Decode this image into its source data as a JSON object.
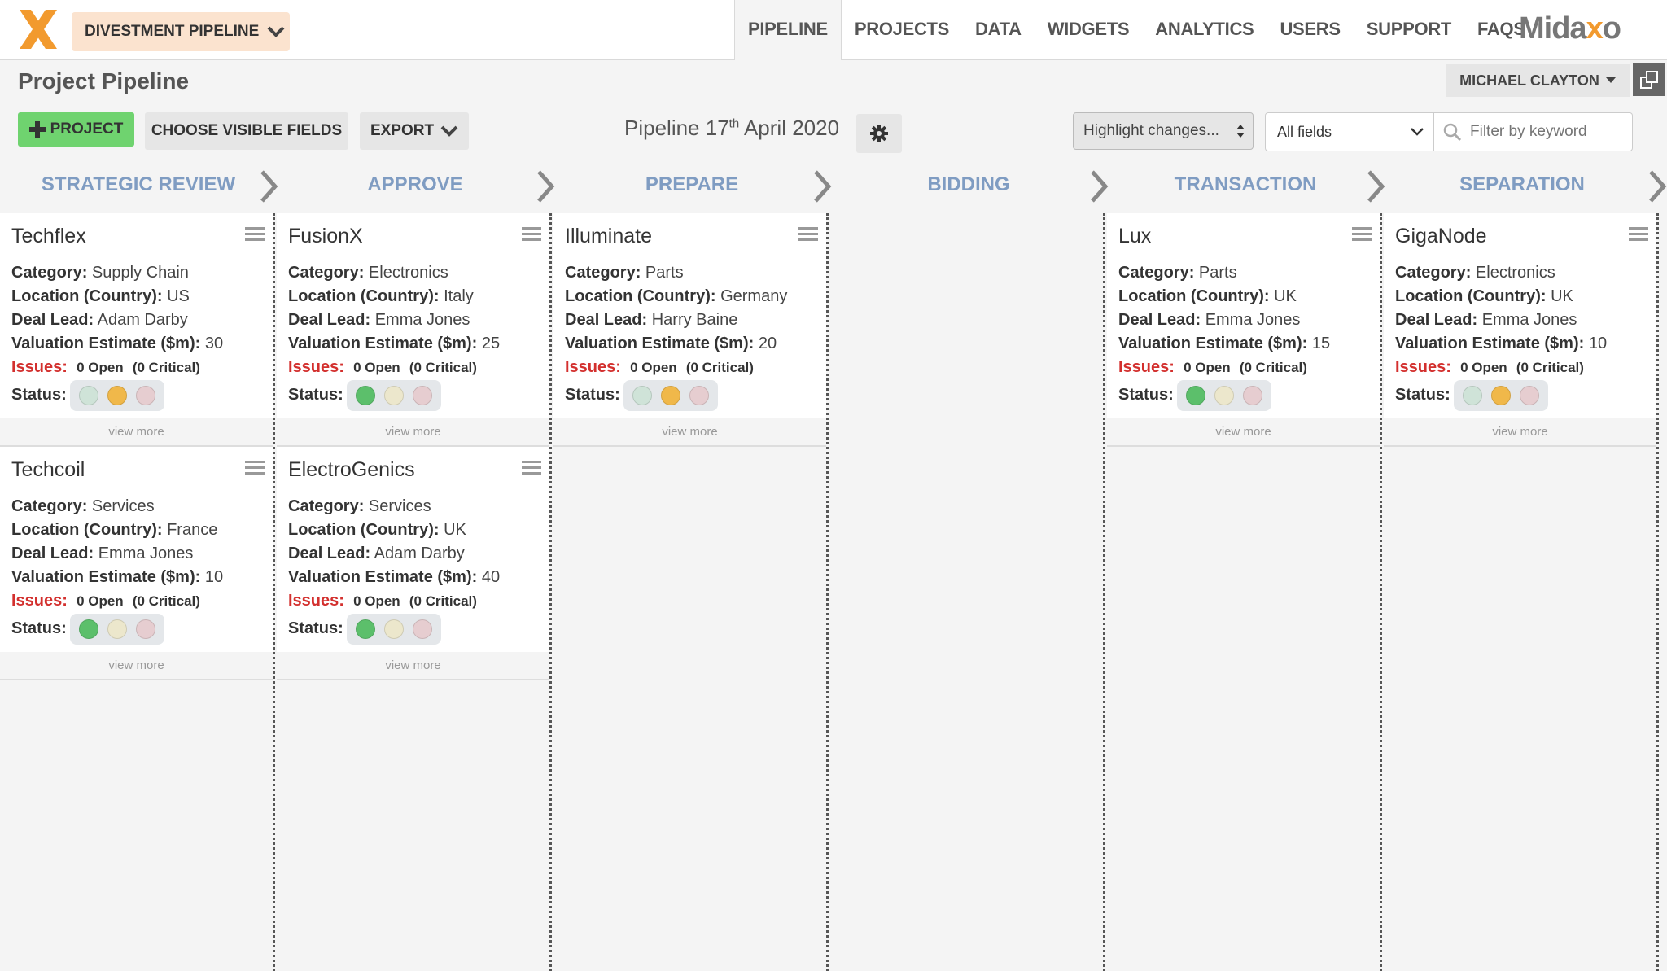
{
  "brand": {
    "logo": "X",
    "name_prefix": "Mida",
    "name_x": "x",
    "name_suffix": "o"
  },
  "pipeline_selector": "DIVESTMENT PIPELINE",
  "nav": [
    "PIPELINE",
    "PROJECTS",
    "DATA",
    "WIDGETS",
    "ANALYTICS",
    "USERS",
    "SUPPORT",
    "FAQS"
  ],
  "page_title": "Project Pipeline",
  "user": "MICHAEL CLAYTON",
  "toolbar": {
    "add_project": "PROJECT",
    "choose_fields": "CHOOSE VISIBLE FIELDS",
    "export": "EXPORT",
    "date_prefix": "Pipeline 17",
    "date_sup": "th",
    "date_suffix": " April 2020",
    "highlight": "Highlight changes...",
    "fields": "All fields",
    "search_placeholder": "Filter by keyword"
  },
  "labels": {
    "category": "Category:",
    "location": "Location (Country):",
    "deal_lead": "Deal Lead:",
    "valuation": "Valuation Estimate ($m):",
    "issues": "Issues:",
    "status": "Status:",
    "view_more": "view more"
  },
  "stages": [
    {
      "name": "STRATEGIC REVIEW",
      "cards": [
        {
          "title": "Techflex",
          "category": "Supply Chain",
          "location": "US",
          "deal_lead": "Adam Darby",
          "valuation": "30",
          "issues_open": "0 Open",
          "issues_critical": "(0 Critical)",
          "status": "amber"
        },
        {
          "title": "Techcoil",
          "category": "Services",
          "location": "France",
          "deal_lead": "Emma Jones",
          "valuation": "10",
          "issues_open": "0 Open",
          "issues_critical": "(0 Critical)",
          "status": "green"
        }
      ]
    },
    {
      "name": "APPROVE",
      "cards": [
        {
          "title": "FusionX",
          "category": "Electronics",
          "location": "Italy",
          "deal_lead": "Emma Jones",
          "valuation": "25",
          "issues_open": "0 Open",
          "issues_critical": "(0 Critical)",
          "status": "green"
        },
        {
          "title": "ElectroGenics",
          "category": "Services",
          "location": "UK",
          "deal_lead": "Adam Darby",
          "valuation": "40",
          "issues_open": "0 Open",
          "issues_critical": "(0 Critical)",
          "status": "green"
        }
      ]
    },
    {
      "name": "PREPARE",
      "cards": [
        {
          "title": "Illuminate",
          "category": "Parts",
          "location": "Germany",
          "deal_lead": "Harry Baine",
          "valuation": "20",
          "issues_open": "0 Open",
          "issues_critical": "(0 Critical)",
          "status": "amber"
        }
      ]
    },
    {
      "name": "BIDDING",
      "cards": []
    },
    {
      "name": "TRANSACTION",
      "cards": [
        {
          "title": "Lux",
          "category": "Parts",
          "location": "UK",
          "deal_lead": "Emma Jones",
          "valuation": "15",
          "issues_open": "0 Open",
          "issues_critical": "(0 Critical)",
          "status": "green"
        }
      ]
    },
    {
      "name": "SEPARATION",
      "cards": [
        {
          "title": "GigaNode",
          "category": "Electronics",
          "location": "UK",
          "deal_lead": "Emma Jones",
          "valuation": "10",
          "issues_open": "0 Open",
          "issues_critical": "(0 Critical)",
          "status": "amber"
        }
      ]
    }
  ],
  "colors": {
    "accent_orange": "#f29a2e",
    "stage_blue": "#7f9cc2",
    "issues_red": "#d3302e",
    "add_green": "#6fd36f",
    "status_green": "#5cbf6b",
    "status_amber": "#f0b84a",
    "light_green_off": "#cfe3d8",
    "light_amber_off": "#ece7cc",
    "light_red_off": "#e6cdd0"
  }
}
